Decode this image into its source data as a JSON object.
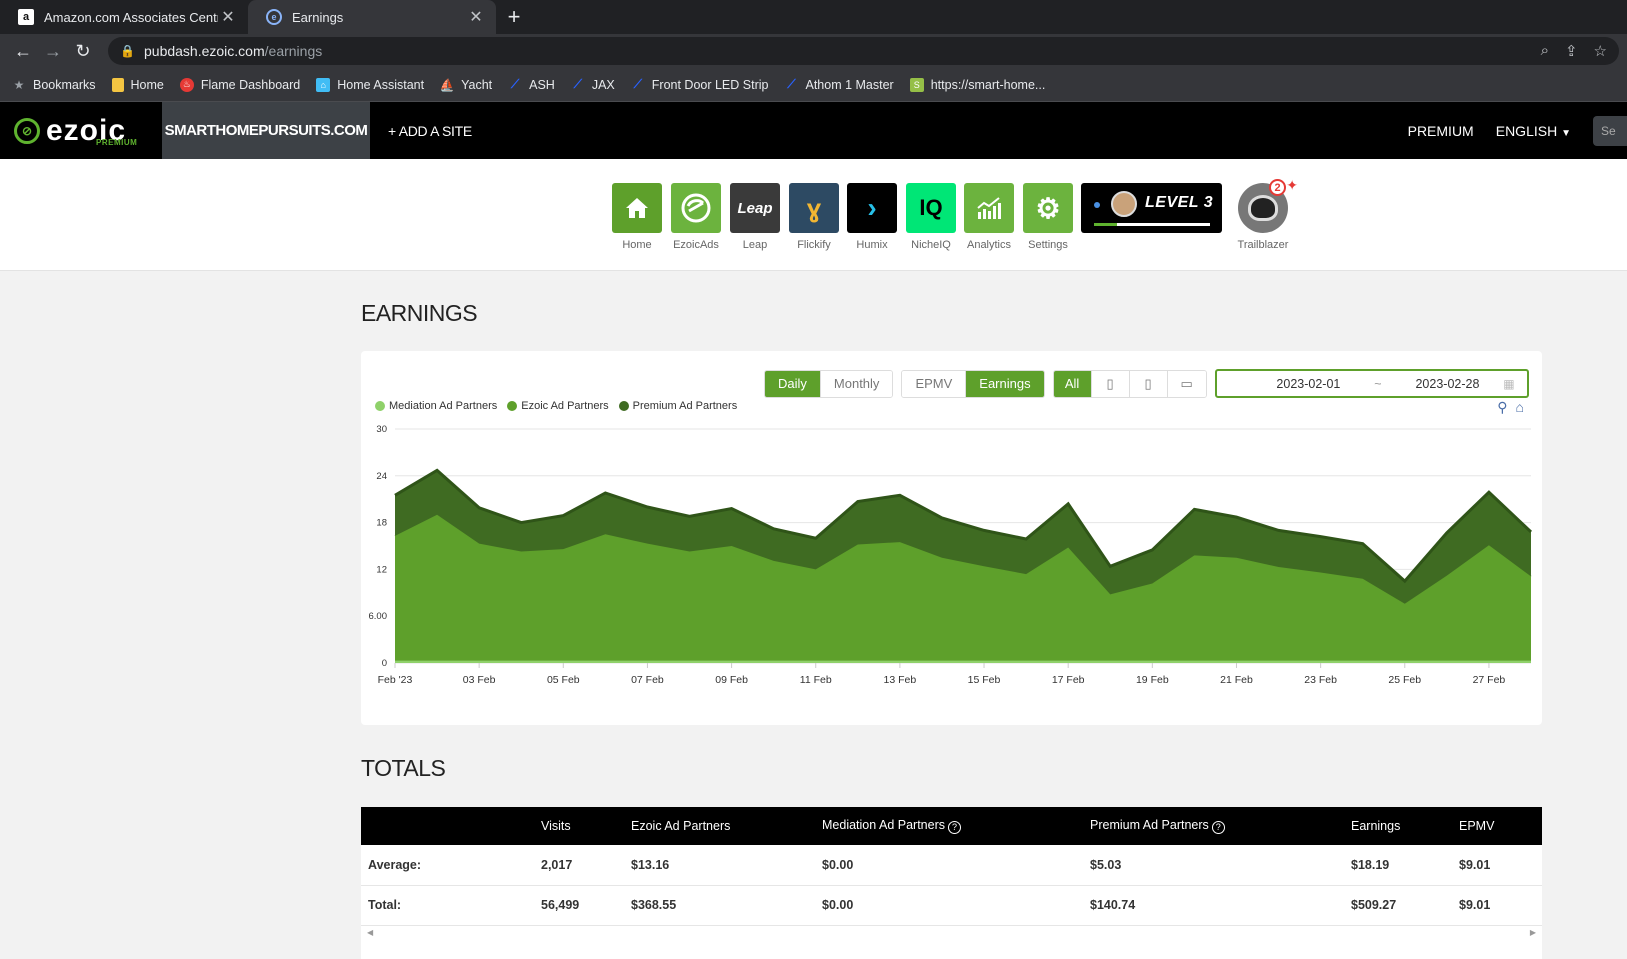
{
  "browser": {
    "tabs": [
      {
        "title": "Amazon.com Associates Central",
        "favicon": "amazon-icon",
        "active": false
      },
      {
        "title": "Earnings",
        "favicon": "ezoic-icon",
        "active": true
      }
    ],
    "url_host": "pubdash.ezoic.com",
    "url_path": "/earnings",
    "bookmarks": [
      {
        "label": "Bookmarks",
        "icon": "star-icon"
      },
      {
        "label": "Home",
        "icon": "folder-icon"
      },
      {
        "label": "Flame Dashboard",
        "icon": "flame-icon"
      },
      {
        "label": "Home Assistant",
        "icon": "home-assistant-icon"
      },
      {
        "label": "Yacht",
        "icon": "yacht-icon"
      },
      {
        "label": "ASH",
        "icon": "led-icon"
      },
      {
        "label": "JAX",
        "icon": "led-icon"
      },
      {
        "label": "Front Door LED Strip",
        "icon": "led-icon"
      },
      {
        "label": "Athom 1 Master",
        "icon": "led-icon"
      },
      {
        "label": "https://smart-home...",
        "icon": "shopify-icon"
      }
    ]
  },
  "header": {
    "logo": "ezoic",
    "logo_sub": "PREMIUM",
    "site": "SMARTHOMEPURSUITS.COM",
    "add_site": "+ ADD A SITE",
    "premium": "PREMIUM",
    "language": "ENGLISH",
    "search_placeholder": "Se"
  },
  "apps": [
    {
      "label": "Home",
      "icon": "house-icon",
      "color": "#5ea02b"
    },
    {
      "label": "EzoicAds",
      "icon": "ezoic-ads-icon",
      "color": "#6cb33e"
    },
    {
      "label": "Leap",
      "icon": "leap-icon",
      "color": "#3a3a3a",
      "text": "Leap"
    },
    {
      "label": "Flickify",
      "icon": "flickify-icon",
      "color": "#2d4a63"
    },
    {
      "label": "Humix",
      "icon": "humix-icon",
      "color": "#000000"
    },
    {
      "label": "NicheIQ",
      "icon": "nicheiq-icon",
      "color": "#00e676",
      "text": "IQ"
    },
    {
      "label": "Analytics",
      "icon": "analytics-icon",
      "color": "#6cb33e"
    },
    {
      "label": "Settings",
      "icon": "gear-icon",
      "color": "#6cb33e"
    }
  ],
  "level": {
    "text": "LEVEL 3",
    "progress": 0.2
  },
  "trailblazer": {
    "label": "Trailblazer",
    "badge": "2"
  },
  "earnings": {
    "title": "EARNINGS",
    "period_buttons": [
      "Daily",
      "Monthly"
    ],
    "period_active": "Daily",
    "metric_buttons": [
      "EPMV",
      "Earnings"
    ],
    "metric_active": "Earnings",
    "device_all": "All",
    "date_start": "2023-02-01",
    "date_sep": "~",
    "date_end": "2023-02-28"
  },
  "chart_data": {
    "type": "area",
    "stacked": true,
    "x": [
      "Feb '23",
      "02 Feb",
      "03 Feb",
      "04 Feb",
      "05 Feb",
      "06 Feb",
      "07 Feb",
      "08 Feb",
      "09 Feb",
      "10 Feb",
      "11 Feb",
      "12 Feb",
      "13 Feb",
      "14 Feb",
      "15 Feb",
      "16 Feb",
      "17 Feb",
      "18 Feb",
      "19 Feb",
      "20 Feb",
      "21 Feb",
      "22 Feb",
      "23 Feb",
      "24 Feb",
      "25 Feb",
      "26 Feb",
      "27 Feb",
      "28 Feb"
    ],
    "x_tick_labels": [
      "Feb '23",
      "03 Feb",
      "05 Feb",
      "07 Feb",
      "09 Feb",
      "11 Feb",
      "13 Feb",
      "15 Feb",
      "17 Feb",
      "19 Feb",
      "21 Feb",
      "23 Feb",
      "25 Feb",
      "27 Feb"
    ],
    "y_tick_labels": [
      "0",
      "6.00",
      "12",
      "18",
      "24",
      "30"
    ],
    "ylim": [
      0,
      30
    ],
    "legend_position": "top-left",
    "grid": true,
    "series": [
      {
        "name": "Mediation Ad Partners",
        "color": "#8fd16a",
        "values": [
          0.3,
          0.3,
          0.3,
          0.3,
          0.3,
          0.3,
          0.3,
          0.3,
          0.3,
          0.3,
          0.3,
          0.3,
          0.3,
          0.3,
          0.3,
          0.3,
          0.3,
          0.3,
          0.3,
          0.3,
          0.3,
          0.3,
          0.3,
          0.3,
          0.3,
          0.3,
          0.3,
          0.3
        ]
      },
      {
        "name": "Ezoic Ad Partners",
        "color": "#5ea02b",
        "values": [
          16.0,
          18.7,
          15.0,
          14.0,
          14.3,
          16.2,
          15.0,
          14.0,
          14.7,
          12.8,
          11.7,
          14.9,
          15.2,
          13.2,
          12.1,
          11.1,
          14.5,
          8.5,
          9.9,
          13.5,
          13.2,
          12.0,
          11.3,
          10.5,
          7.3,
          10.9,
          14.8,
          10.8
        ]
      },
      {
        "name": "Premium Ad Partners",
        "color": "#3f6b22",
        "values": [
          5.2,
          5.7,
          4.6,
          3.7,
          4.3,
          5.3,
          4.7,
          4.5,
          4.8,
          4.1,
          4.0,
          5.5,
          6.0,
          5.1,
          4.6,
          4.5,
          5.6,
          3.6,
          4.3,
          5.9,
          5.2,
          4.7,
          4.6,
          4.5,
          2.9,
          5.5,
          6.8,
          5.7
        ]
      }
    ]
  },
  "totals": {
    "title": "TOTALS",
    "columns": [
      "",
      "Visits",
      "Ezoic Ad Partners",
      "Mediation Ad Partners",
      "Premium Ad Partners",
      "Earnings",
      "EPMV"
    ],
    "rows": [
      [
        "Average:",
        "2,017",
        "$13.16",
        "$0.00",
        "$5.03",
        "$18.19",
        "$9.01"
      ],
      [
        "Total:",
        "56,499",
        "$368.55",
        "$0.00",
        "$140.74",
        "$509.27",
        "$9.01"
      ]
    ]
  }
}
